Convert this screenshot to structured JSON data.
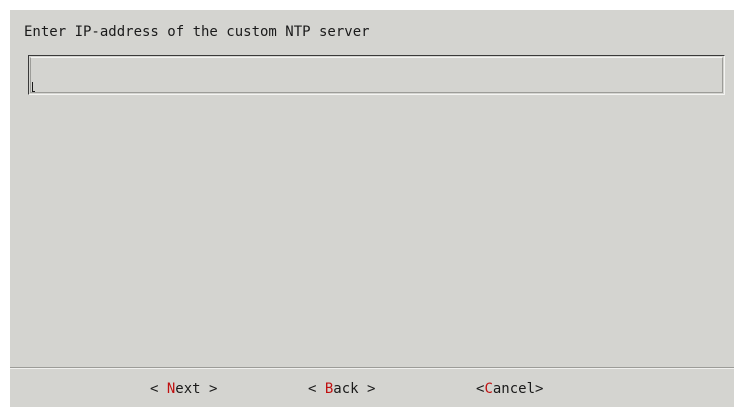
{
  "dialog": {
    "prompt": "Enter IP-address of the custom NTP server",
    "input": {
      "value": "",
      "placeholder": ""
    },
    "buttons": {
      "next": {
        "open": "< ",
        "hotkey": "N",
        "rest": "ext",
        "close": " >"
      },
      "back": {
        "open": "< ",
        "hotkey": "B",
        "rest": "ack",
        "close": " >"
      },
      "cancel": {
        "open": "<",
        "hotkey": "C",
        "rest": "ancel",
        "close": ">"
      }
    }
  },
  "colors": {
    "dialog_background": "#d4d4d0",
    "hotkey": "#c01010",
    "text": "#1a1a1a"
  }
}
